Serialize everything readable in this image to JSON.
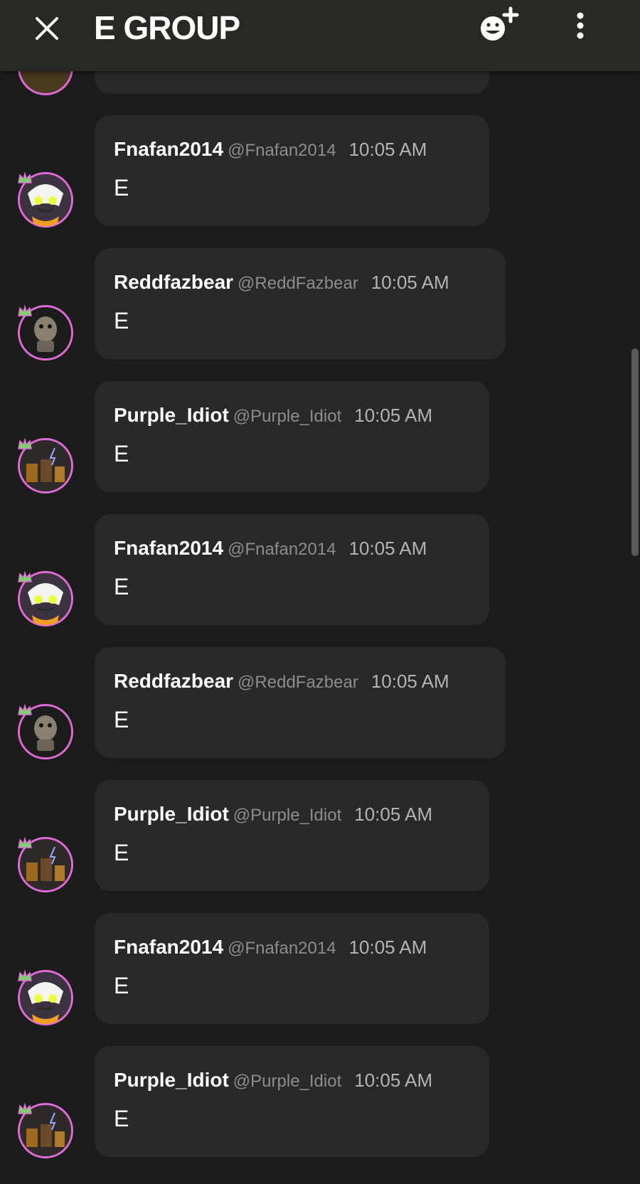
{
  "header": {
    "title": "E GROUP",
    "close_icon": "close-icon",
    "add_member_icon": "add-emoji-plus-icon",
    "more_icon": "more-vertical-icon"
  },
  "colors": {
    "background": "#1d1c1c",
    "header": "#282827",
    "bubble": "#2a2929",
    "avatar_ring": "#e06ad6"
  },
  "messages": [
    {
      "username": "Fnafan2014",
      "handle": "@Fnafan2014",
      "time": "10:05 AM",
      "text": "E"
    },
    {
      "username": "Reddfazbear",
      "handle": "@ReddFazbear",
      "time": "10:05 AM",
      "text": "E"
    },
    {
      "username": "Purple_Idiot",
      "handle": "@Purple_Idiot",
      "time": "10:05 AM",
      "text": "E"
    },
    {
      "username": "Fnafan2014",
      "handle": "@Fnafan2014",
      "time": "10:05 AM",
      "text": "E"
    },
    {
      "username": "Reddfazbear",
      "handle": "@ReddFazbear",
      "time": "10:05 AM",
      "text": "E"
    },
    {
      "username": "Purple_Idiot",
      "handle": "@Purple_Idiot",
      "time": "10:05 AM",
      "text": "E"
    },
    {
      "username": "Fnafan2014",
      "handle": "@Fnafan2014",
      "time": "10:05 AM",
      "text": "E"
    },
    {
      "username": "Purple_Idiot",
      "handle": "@Purple_Idiot",
      "time": "10:05 AM",
      "text": "E"
    }
  ]
}
